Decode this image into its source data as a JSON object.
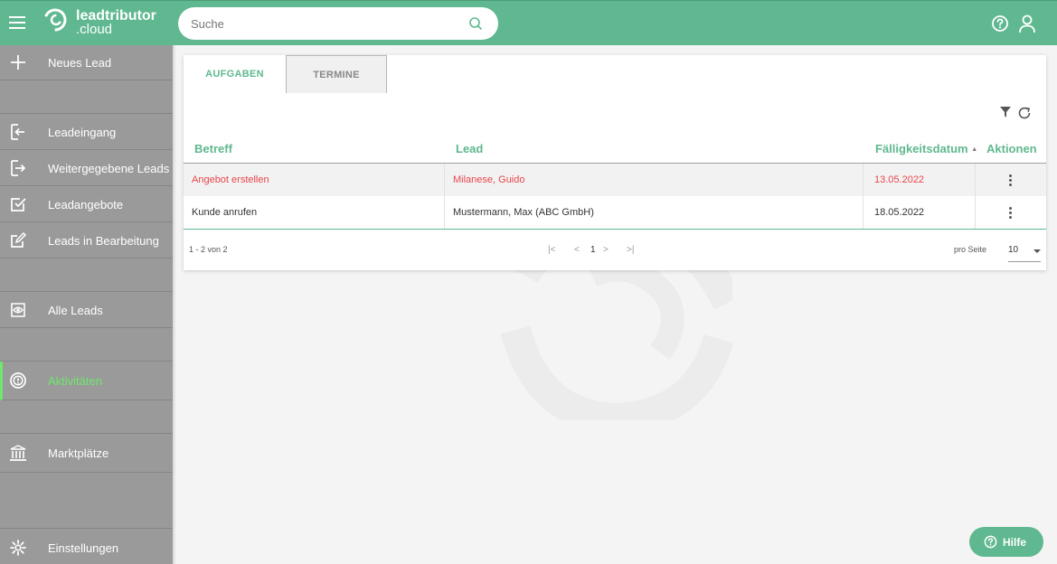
{
  "header": {
    "brand_name": "leadtributor",
    "brand_suffix": ".cloud",
    "search_placeholder": "Suche",
    "search_value": ""
  },
  "colors": {
    "brand_green": "#5fb88f",
    "sidebar_gray": "#9a9a9a",
    "active_green": "#6ee86e",
    "overdue_red": "#e8474c"
  },
  "sidebar": {
    "items": [
      {
        "label": "Neues Lead",
        "icon": "plus-icon"
      },
      {
        "label": "Leadeingang",
        "icon": "sign-in-icon"
      },
      {
        "label": "Weitergegebene Leads",
        "icon": "sign-out-icon"
      },
      {
        "label": "Leadangebote",
        "icon": "checkbox-icon"
      },
      {
        "label": "Leads in Bearbeitung",
        "icon": "edit-icon"
      },
      {
        "label": "Alle Leads",
        "icon": "eye-icon"
      },
      {
        "label": "Aktivitäten",
        "icon": "alert-circle-icon",
        "active": true
      },
      {
        "label": "Marktplätze",
        "icon": "bank-icon"
      },
      {
        "label": "Einstellungen",
        "icon": "gear-icon"
      }
    ]
  },
  "tabs": [
    {
      "label": "AUFGABEN",
      "active": true
    },
    {
      "label": "TERMINE",
      "active": false
    }
  ],
  "table": {
    "columns": [
      "Betreff",
      "Lead",
      "Fälligkeitsdatum",
      "Aktionen"
    ],
    "sort_indicator": "▲",
    "rows": [
      {
        "betreff": "Angebot erstellen",
        "lead": "Milanese, Guido",
        "faellig": "13.05.2022",
        "overdue": true
      },
      {
        "betreff": "Kunde anrufen",
        "lead": "Mustermann, Max (ABC GmbH)",
        "faellig": "18.05.2022",
        "overdue": false
      }
    ]
  },
  "pagination": {
    "range": "1 - 2 von 2",
    "first": "|<",
    "prev": "<",
    "current_page": "1",
    "next": ">",
    "last": ">|",
    "per_page_label": "pro Seite",
    "per_page_value": "10"
  },
  "help_button": {
    "label": "Hilfe"
  }
}
